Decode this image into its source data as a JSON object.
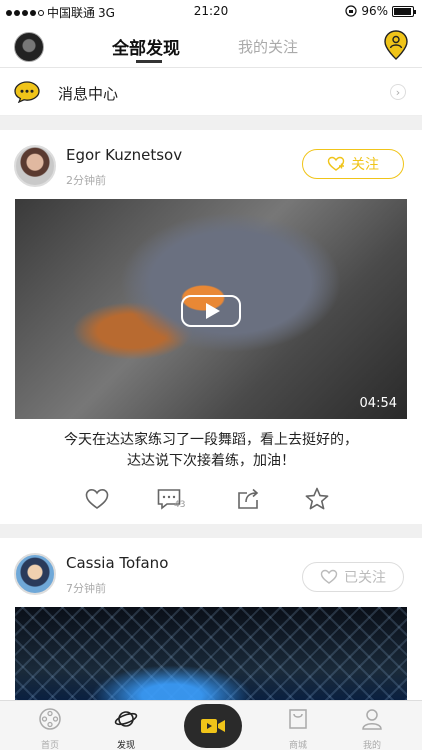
{
  "status_bar": {
    "carrier": "中国联通",
    "network": "3G",
    "time": "21:20",
    "battery": "96%",
    "battery_level": 0.96
  },
  "header": {
    "tab_active": "全部发现",
    "tab_inactive": "我的关注"
  },
  "message_center": {
    "label": "消息中心"
  },
  "posts": [
    {
      "author": "Egor Kuznetsov",
      "time": "2分钟前",
      "follow_label": "关注",
      "duration": "04:54",
      "caption_line1": "今天在达达家练习了一段舞蹈，看上去挺好的，",
      "caption_line2": "达达说下次接着练，加油！",
      "comment_count": "43"
    },
    {
      "author": "Cassia Tofano",
      "time": "7分钟前",
      "follow_label": "已关注"
    }
  ],
  "tabbar": {
    "items": [
      {
        "label": "首页",
        "icon": "film-reel-icon"
      },
      {
        "label": "发现",
        "icon": "planet-icon"
      },
      {
        "label": "",
        "icon": "video-camera-icon"
      },
      {
        "label": "商城",
        "icon": "shopping-bag-icon"
      },
      {
        "label": "我的",
        "icon": "person-icon"
      }
    ]
  },
  "colors": {
    "accent": "#f0c419",
    "dark": "#2a2a2a"
  }
}
